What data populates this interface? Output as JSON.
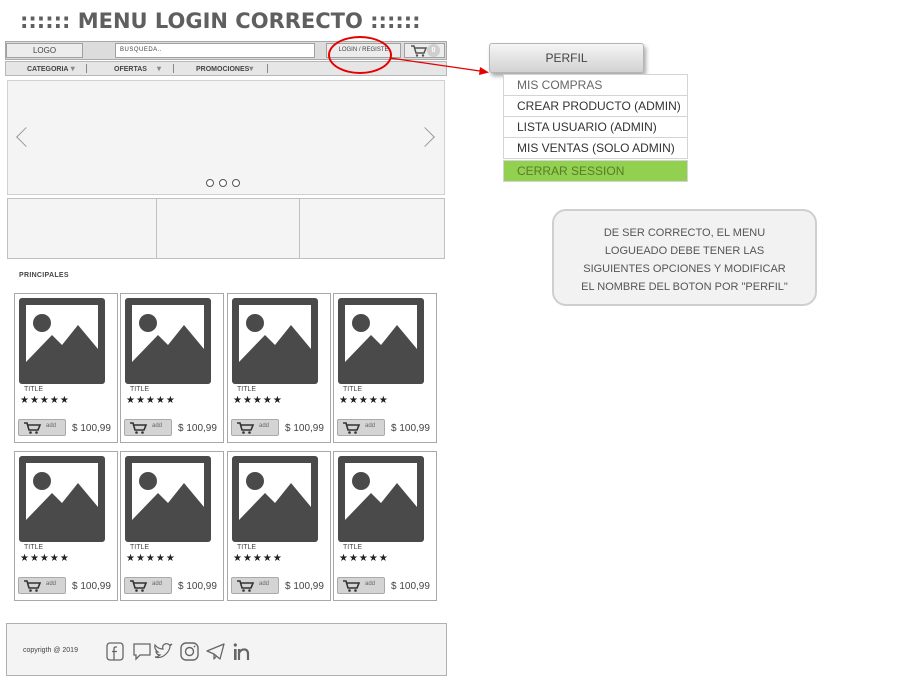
{
  "page_title": "::::::  MENU LOGIN CORRECTO ::::::",
  "header": {
    "logo": "LOGO",
    "search_placeholder": "BUSQUEDA..",
    "login_label": "LOGIN / REGISTE",
    "cart_count": "0"
  },
  "nav": [
    "CATEGORIA",
    "OFERTAS",
    "PROMOCIONES"
  ],
  "section_label": "PRINCIPALES",
  "products": [
    {
      "title": "TITLE",
      "stars": "★★★★★",
      "add": "add",
      "price": "$ 100,99"
    },
    {
      "title": "TITLE",
      "stars": "★★★★★",
      "add": "add",
      "price": "$ 100,99"
    },
    {
      "title": "TITLE",
      "stars": "★★★★★",
      "add": "add",
      "price": "$ 100,99"
    },
    {
      "title": "TITLE",
      "stars": "★★★★★",
      "add": "add",
      "price": "$ 100,99"
    },
    {
      "title": "TITLE",
      "stars": "★★★★★",
      "add": "add",
      "price": "$ 100,99"
    },
    {
      "title": "TITLE",
      "stars": "★★★★★",
      "add": "add",
      "price": "$ 100,99"
    },
    {
      "title": "TITLE",
      "stars": "★★★★★",
      "add": "add",
      "price": "$ 100,99"
    },
    {
      "title": "TITLE",
      "stars": "★★★★★",
      "add": "add",
      "price": "$ 100,99"
    }
  ],
  "footer": {
    "copyright": "copyrigth @ 2019",
    "social_icons": [
      "facebook-icon",
      "chat-icon",
      "twitter-icon",
      "instagram-icon",
      "telegram-icon",
      "linkedin-icon"
    ]
  },
  "perfil_button": "PERFIL",
  "perfil_menu": [
    "MIS COMPRAS",
    "CREAR PRODUCTO (ADMIN)",
    "LISTA USUARIO (ADMIN)",
    "MIS VENTAS (SOLO ADMIN)",
    "CERRAR SESSION"
  ],
  "note_lines": [
    "DE SER CORRECTO, EL MENU",
    "LOGUEADO DEBE TENER  LAS",
    "SIGUIENTES OPCIONES Y MODIFICAR",
    "EL NOMBRE DEL BOTON POR \"PERFIL\""
  ],
  "colors": {
    "highlight": "#e60000",
    "logout_bg": "#92d050"
  }
}
